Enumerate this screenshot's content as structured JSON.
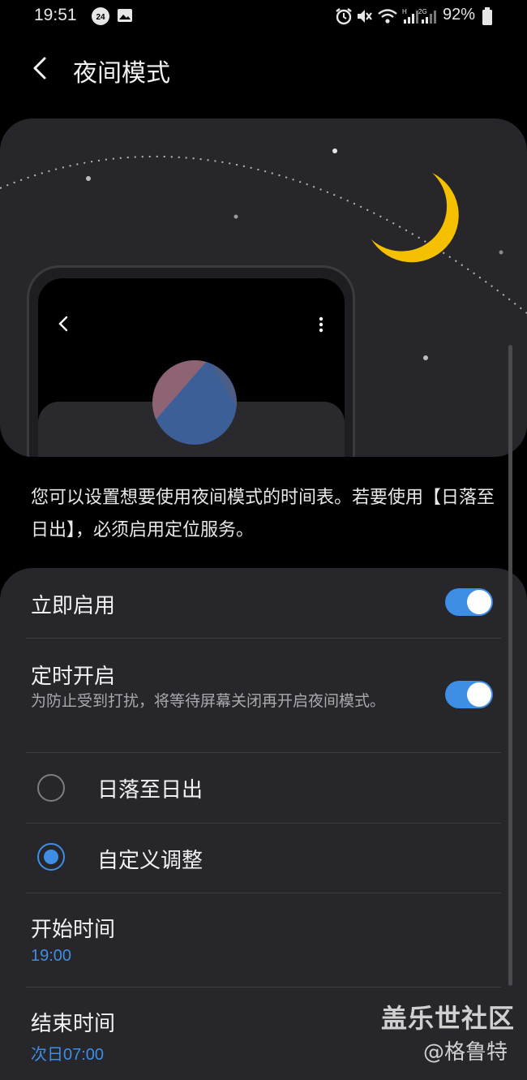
{
  "status_bar": {
    "time": "19:51",
    "battery": "92%",
    "icons": [
      "24h-badge-icon",
      "gallery-icon",
      "alarm-icon",
      "mute-icon",
      "wifi-icon",
      "signal-h-icon",
      "signal-2g-icon",
      "battery-icon"
    ],
    "badge_24": "24"
  },
  "header": {
    "title": "夜间模式"
  },
  "description": "您可以设置想要使用夜间模式的时间表。若要使用【日落至日出】，必须启用定位服务。",
  "settings": {
    "enable_now": {
      "label": "立即启用",
      "on": true
    },
    "scheduled": {
      "label": "定时开启",
      "subtitle": "为防止受到打扰，将等待屏幕关闭再开启夜间模式。",
      "on": true
    },
    "options": [
      {
        "label": "日落至日出",
        "selected": false
      },
      {
        "label": "自定义调整",
        "selected": true
      }
    ],
    "start_time": {
      "label": "开始时间",
      "value": "19:00"
    },
    "end_time": {
      "label": "结束时间",
      "value": "次日07:00"
    }
  },
  "watermark": {
    "line1": "盖乐世社区",
    "line2": "@格鲁特"
  },
  "colors": {
    "accent": "#3e8ee6",
    "card": "#26262b",
    "moon": "#f5c000"
  }
}
